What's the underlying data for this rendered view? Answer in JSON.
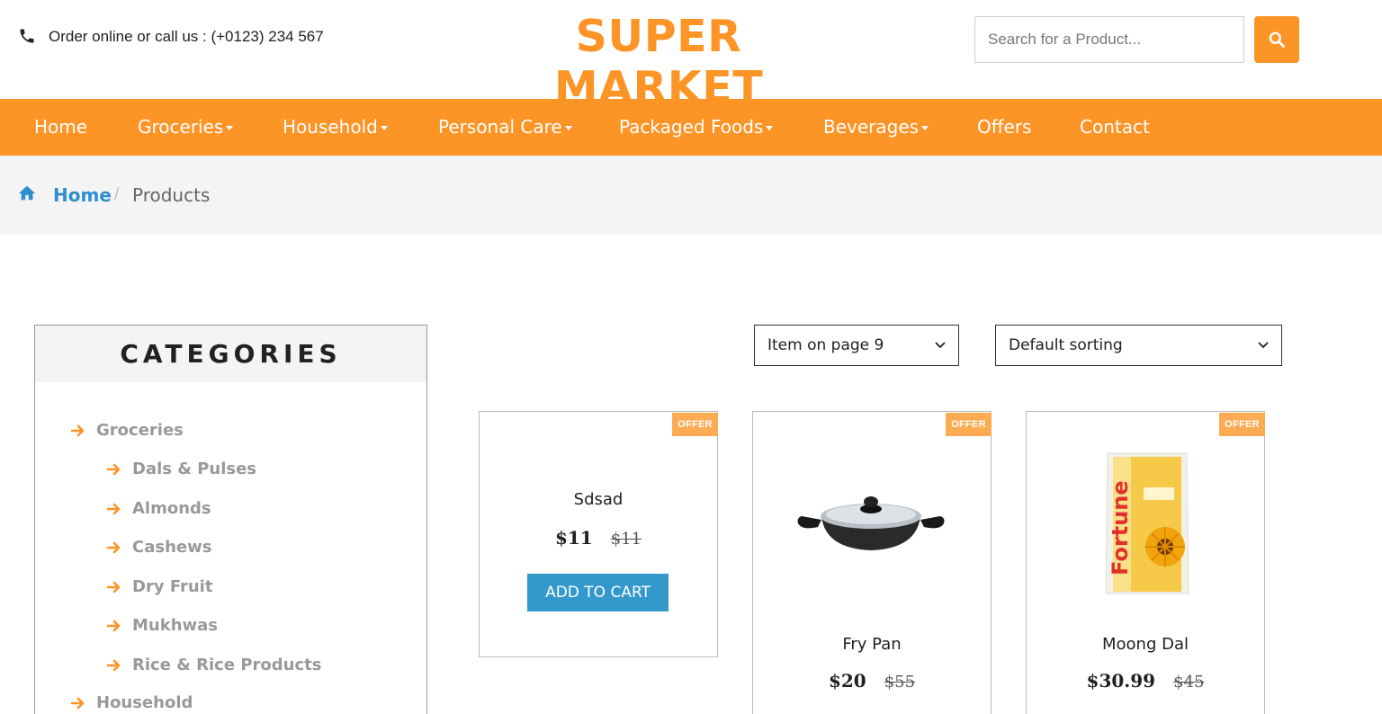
{
  "header": {
    "call_text": "Order online or call us : (+0123) 234 567",
    "brand": "SUPER MARKET",
    "search_placeholder": "Search for a Product..."
  },
  "nav": {
    "items": [
      {
        "label": "Home",
        "dropdown": false
      },
      {
        "label": "Groceries",
        "dropdown": true
      },
      {
        "label": "Household",
        "dropdown": true
      },
      {
        "label": "Personal Care",
        "dropdown": true
      },
      {
        "label": "Packaged Foods",
        "dropdown": true
      },
      {
        "label": "Beverages",
        "dropdown": true
      },
      {
        "label": "Offers",
        "dropdown": false
      },
      {
        "label": "Contact",
        "dropdown": false
      }
    ]
  },
  "breadcrumb": {
    "home": "Home",
    "separator": "/",
    "current": "Products"
  },
  "sidebar": {
    "title": "CATEGORIES",
    "categories": [
      {
        "label": "Groceries",
        "level": 0
      },
      {
        "label": "Dals & Pulses",
        "level": 1
      },
      {
        "label": "Almonds",
        "level": 1
      },
      {
        "label": "Cashews",
        "level": 1
      },
      {
        "label": "Dry Fruit",
        "level": 1
      },
      {
        "label": "Mukhwas",
        "level": 1
      },
      {
        "label": "Rice & Rice Products",
        "level": 1
      },
      {
        "label": "Household",
        "level": 0
      }
    ]
  },
  "toolbar": {
    "items_per_page": "Item on page 9",
    "sorting": "Default sorting"
  },
  "products": [
    {
      "name": "Sdsad",
      "price": "$11",
      "old_price": "$11",
      "badge": "OFFER",
      "cta": "ADD TO CART",
      "image": "none"
    },
    {
      "name": "Fry Pan",
      "price": "$20",
      "old_price": "$55",
      "badge": "OFFER",
      "image": "fry-pan"
    },
    {
      "name": "Moong Dal",
      "price": "$30.99",
      "old_price": "$45",
      "badge": "OFFER",
      "image": "fortune-oil-pack",
      "image_text": "Fortune"
    }
  ],
  "colors": {
    "accent": "#fd9426",
    "offer_badge": "#fdab52",
    "link_blue": "#2f8fce",
    "cart_button": "#3399cc",
    "breadcrumb_bg": "#f4f4f4"
  }
}
